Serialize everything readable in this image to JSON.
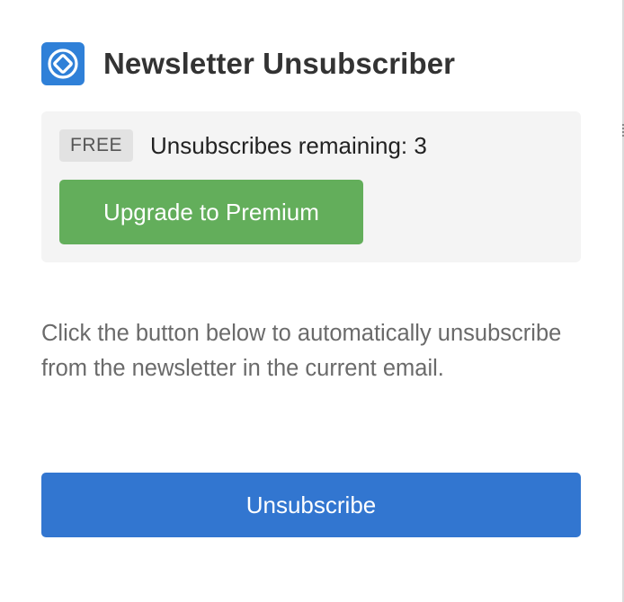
{
  "app": {
    "title": "Newsletter Unsubscriber",
    "logo_icon": "diamond-icon",
    "logo_color": "#2f80d8"
  },
  "plan": {
    "badge": "FREE",
    "remaining_text": "Unsubscribes remaining: 3",
    "upgrade_label": "Upgrade to Premium",
    "upgrade_color": "#63ae5b"
  },
  "main": {
    "description": "Click the button below to automatically unsubscribe from the newsletter in the current email.",
    "unsubscribe_label": "Unsubscribe",
    "unsubscribe_color": "#3276d0"
  }
}
